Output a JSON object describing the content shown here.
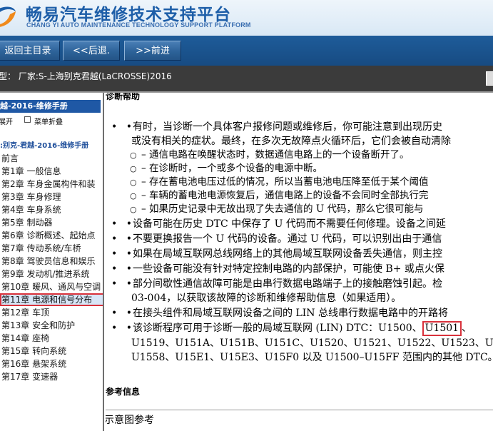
{
  "header": {
    "title": "畅易汽车维修技术支持平台",
    "subtitle": "CHANG YI AUTO MAINTENANCE TECHNOLOGY SUPPORT PLATFORM",
    "logo_icon": "swirl-logo-icon",
    "brand_color": "#1d5ea8"
  },
  "nav": {
    "home_label": "返回主目录",
    "back_label": "<<后退.",
    "forward_label": ">>前进"
  },
  "vehicle": {
    "info": "型：  厂家:S-上海别克君越(LaCROSSE)2016"
  },
  "sidebar": {
    "manual_title": "越-2016-维修手册",
    "expand_label": "展开",
    "collapse_label": "菜单折叠",
    "tree_root": ":别克-君越-2016-维修手册",
    "items": [
      "前言",
      "第1章 一般信息",
      "第2章 车身金属构件和装",
      "第3章 车身修理",
      "第4章 车身系统",
      "第5章 制动器",
      "第6章 诊断概述、起始点",
      "第7章 传动系统/车桥",
      "第8章 驾驶员信息和娱乐",
      "第9章 发动机/推进系统",
      "第10章 暖风、通风与空调",
      "第11章 电源和信号分布",
      "第12章 车顶",
      "第13章 安全和防护",
      "第14章 座椅",
      "第15章 转向系统",
      "第16章 悬架系统",
      "第17章 变速器"
    ],
    "selected_index": 11,
    "highlight_color": "#d9313b"
  },
  "content": {
    "heading": "诊断帮助",
    "bullet1_line1": "有时，当诊断一个具体客户报修问题或维修后，你可能注意到出现历史",
    "bullet1_line2": "或没有相关的症状。最终，在多次无故障点火循环后，它们会被自动清除",
    "sub_items": [
      "– 通信电路在唤醒状态时，数据通信电路上的一个设备断开了。",
      "– 在诊断时，一个或多个设备的电源中断。",
      "– 存在蓄电池电压过低的情况，所以当蓄电池电压降至低于某个阈值",
      "– 车辆的蓄电池电源恢复后，通信电路上的设备不会同时全部执行完",
      "– 如果历史记录中无故出现了失去通信的 U 代码，那么它很可能与"
    ],
    "bullet2": "设备可能在历史 DTC 中保存了 U 代码而不需要任何修理。设备之间延",
    "bullet3": "不要更换报告一个 U 代码的设备。通过 U 代码，可以识别出由于通信",
    "bullet4": "如果在局域互联网总线网络上的其他局域互联网设备丢失通信，则主控",
    "bullet5": "一些设备可能没有针对特定控制电路的内部保护，可能使 B+ 或点火保",
    "bullet6_line1": "部分间歇性通信故障可能是由串行数据电路端子上的接触磨蚀引起。检",
    "bullet6_line2": "03-004，以获取该故障的诊断和维修帮助信息（如果适用）。",
    "bullet7": "在接头组件和局域互联网设备之间的 LIN 总线串行数据电路中的开路将",
    "bullet8_prefix": "该诊断程序可用于诊断一般的局域互联网 (LIN) DTC：U1500、",
    "bullet8_highlight": "U1501",
    "bullet8_suffix": "、",
    "bullet8_line2": "U1519、U151A、U151B、U151C、U1520、U1521、U1522、U1523、U1",
    "bullet8_line3": "U1558、U15E1、U15E3、U15F0 以及 U1500–U15FF 范围内的其他 DTC。",
    "reference_heading": "参考信息",
    "diagram_ref": "示意图参考"
  }
}
